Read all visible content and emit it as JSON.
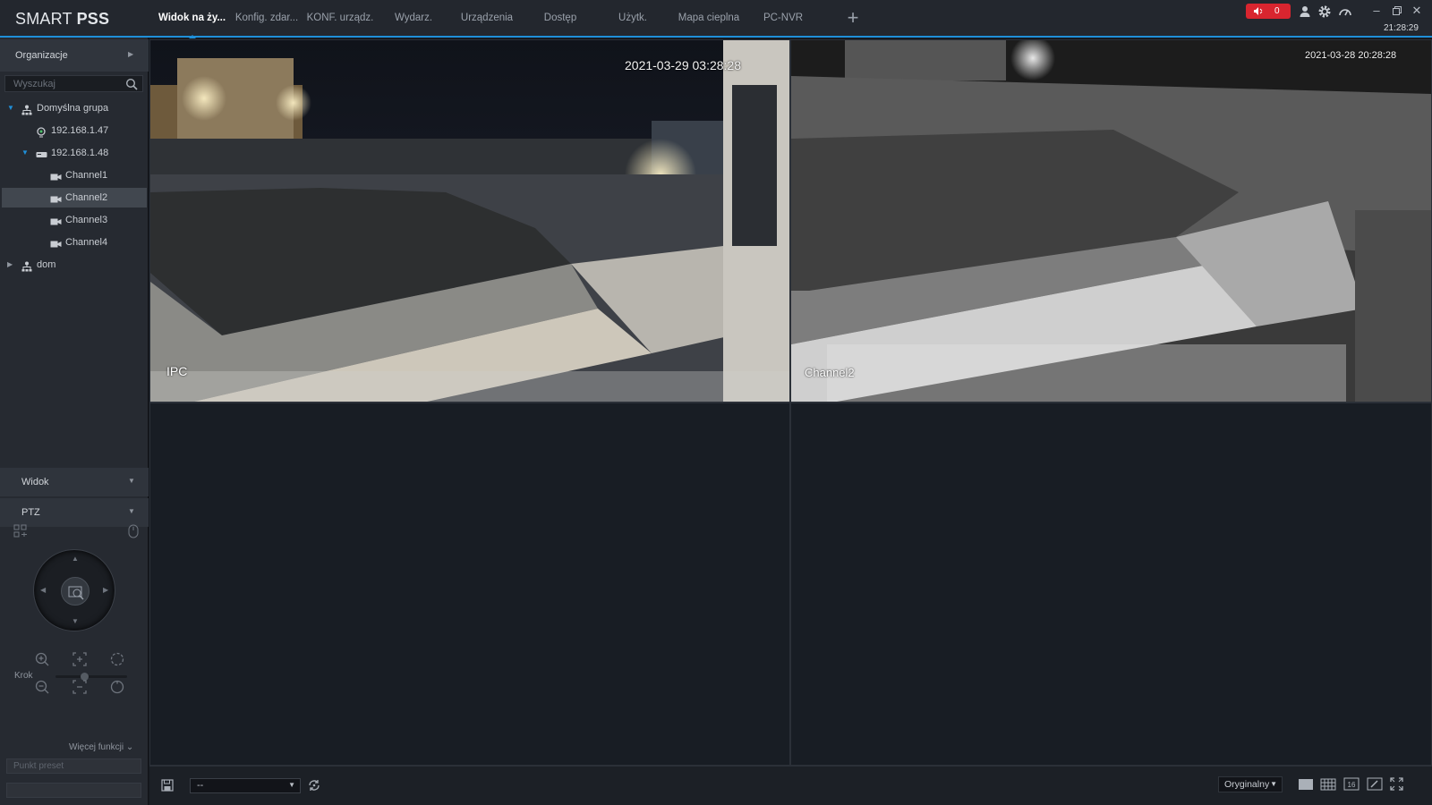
{
  "app": {
    "logo_light": "SMART",
    "logo_bold": "PSS",
    "clock": "21:28:29",
    "alarm_count": "0",
    "accent": "#1f8fd8",
    "alarm_color": "#d8252f"
  },
  "tabs": [
    {
      "label": "Widok na ży...",
      "active": true
    },
    {
      "label": "Konfig. zdar...",
      "active": false
    },
    {
      "label": "KONF. urządz.",
      "active": false
    },
    {
      "label": "Wydarz.",
      "active": false
    },
    {
      "label": "Urządzenia",
      "active": false
    },
    {
      "label": "Dostęp",
      "active": false
    },
    {
      "label": "Użytk.",
      "active": false
    },
    {
      "label": "Mapa cieplna",
      "active": false
    },
    {
      "label": "PC-NVR",
      "active": false
    }
  ],
  "top_icons": [
    "speaker-icon",
    "user-icon",
    "settings-icon",
    "performance-icon",
    "minimize-icon",
    "restore-icon",
    "close-icon"
  ],
  "sidebar": {
    "header": "Organizacje",
    "search_placeholder": "Wyszukaj",
    "tree": [
      {
        "label": "Domyślna grupa",
        "level": 0,
        "expanded": true,
        "icon": "group-icon"
      },
      {
        "label": "192.168.1.47",
        "level": 1,
        "icon": "ipc-camera-icon"
      },
      {
        "label": "192.168.1.48",
        "level": 1,
        "expanded": true,
        "icon": "nvr-device-icon"
      },
      {
        "label": "Channel1",
        "level": 2,
        "icon": "channel-camera-icon"
      },
      {
        "label": "Channel2",
        "level": 2,
        "icon": "channel-camera-icon",
        "selected": true
      },
      {
        "label": "Channel3",
        "level": 2,
        "icon": "channel-camera-icon"
      },
      {
        "label": "Channel4",
        "level": 2,
        "icon": "channel-camera-icon"
      },
      {
        "label": "dom",
        "level": 0,
        "expanded": false,
        "icon": "group-icon"
      }
    ],
    "view_section": "Widok",
    "ptz_section": "PTZ",
    "step_label": "Krok",
    "step_value": 0.4,
    "more_functions": "Więcej funkcji",
    "preset_placeholder": "Punkt preset"
  },
  "video": {
    "cells": [
      {
        "timestamp": "2021-03-29 03:28:28",
        "name": "IPC",
        "has_video": true,
        "mode": "color"
      },
      {
        "timestamp": "2021-03-28 20:28:28",
        "name": "Channel2",
        "has_video": true,
        "mode": "mono"
      },
      {
        "has_video": false
      },
      {
        "has_video": false
      }
    ]
  },
  "bottombar": {
    "layout_value": "--",
    "aspect_value": "Oryginalny",
    "layout_buttons": [
      "single-view-icon",
      "grid-view-icon",
      "sixteen-view-icon",
      "custom-layout-icon",
      "fullscreen-icon"
    ]
  }
}
